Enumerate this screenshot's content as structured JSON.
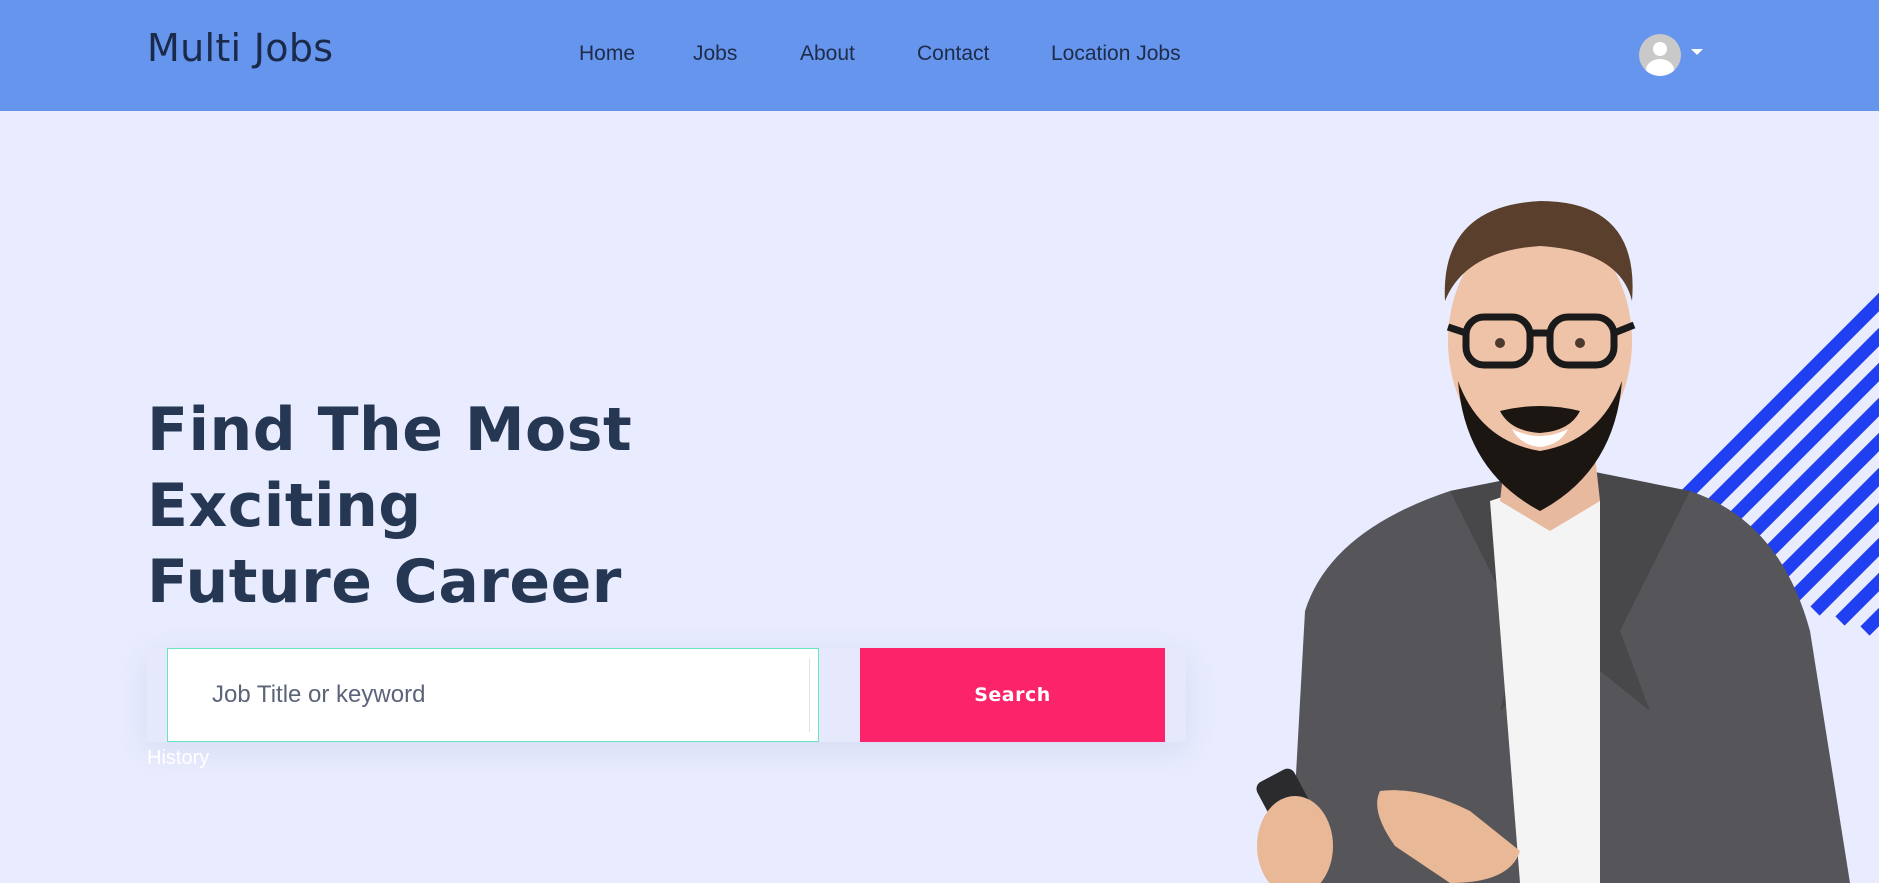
{
  "header": {
    "brand": "Multi Jobs",
    "nav": [
      {
        "label": "Home"
      },
      {
        "label": "Jobs"
      },
      {
        "label": "About"
      },
      {
        "label": "Contact"
      },
      {
        "label": "Location Jobs"
      }
    ],
    "avatar_icon": "user-avatar-icon",
    "dropdown_icon": "caret-down-icon"
  },
  "hero": {
    "title_line1": "Find The Most Exciting",
    "title_line2": "Future Career",
    "search": {
      "placeholder": "Job Title or keyword",
      "value": "",
      "button_label": "Search"
    },
    "history_label": "History"
  },
  "colors": {
    "navbar": "#6595ec",
    "page_background": "#e9ecfe",
    "search_button": "#fb246a",
    "heading": "#263753",
    "stripes": "#1f3ff0"
  }
}
